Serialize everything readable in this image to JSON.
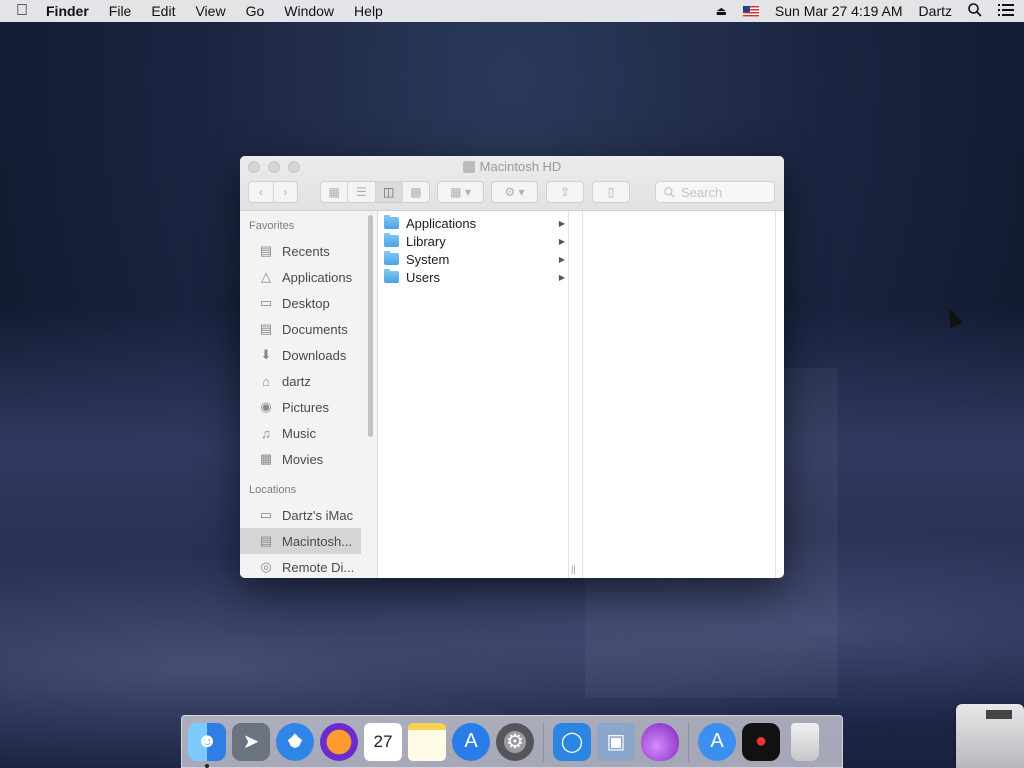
{
  "menubar": {
    "apple_icon": "apple-logo",
    "app_name": "Finder",
    "menus": [
      "File",
      "Edit",
      "View",
      "Go",
      "Window",
      "Help"
    ],
    "datetime": "Sun Mar 27  4:19 AM",
    "user": "Dartz",
    "icons": [
      "eject-icon",
      "us-flag-icon",
      "search-icon",
      "list-icon"
    ]
  },
  "window": {
    "title": "Macintosh HD",
    "search_placeholder": "Search",
    "view_modes": [
      "icon",
      "list",
      "column",
      "gallery"
    ],
    "active_view": "column"
  },
  "sidebar": {
    "favorites_heading": "Favorites",
    "favorites": [
      {
        "label": "Recents",
        "icon": "recents-icon"
      },
      {
        "label": "Applications",
        "icon": "applications-icon"
      },
      {
        "label": "Desktop",
        "icon": "desktop-icon"
      },
      {
        "label": "Documents",
        "icon": "documents-icon"
      },
      {
        "label": "Downloads",
        "icon": "downloads-icon"
      },
      {
        "label": "dartz",
        "icon": "home-icon"
      },
      {
        "label": "Pictures",
        "icon": "camera-icon"
      },
      {
        "label": "Music",
        "icon": "music-icon"
      },
      {
        "label": "Movies",
        "icon": "film-icon"
      }
    ],
    "locations_heading": "Locations",
    "locations": [
      {
        "label": "Dartz's iMac",
        "icon": "imac-icon"
      },
      {
        "label": "Macintosh...",
        "icon": "hard-drive-icon",
        "selected": true
      },
      {
        "label": "Remote Di...",
        "icon": "disc-icon"
      }
    ]
  },
  "column1": {
    "items": [
      {
        "label": "Applications",
        "icon": "folder-applications-icon"
      },
      {
        "label": "Library",
        "icon": "folder-library-icon"
      },
      {
        "label": "System",
        "icon": "folder-system-icon"
      },
      {
        "label": "Users",
        "icon": "folder-users-icon"
      }
    ]
  },
  "dock": {
    "apps": [
      {
        "name": "finder",
        "color": "#3a8ff0",
        "running": true
      },
      {
        "name": "launchpad",
        "color": "#6b7280"
      },
      {
        "name": "safari",
        "color": "#2f86e6"
      },
      {
        "name": "firefox",
        "color": "#6a2bd1"
      },
      {
        "name": "calendar",
        "color": "#ffffff",
        "text": "27"
      },
      {
        "name": "notes",
        "color": "#f7d154"
      },
      {
        "name": "app-store",
        "color": "#2a7ce8"
      },
      {
        "name": "system-preferences",
        "color": "#7d7d83"
      },
      {
        "name": "proxyman",
        "color": "#2a86e0"
      },
      {
        "name": "preview",
        "color": "#8aa6c8"
      },
      {
        "name": "potion",
        "color": "#a24bd8"
      },
      {
        "name": "app-store-downloads",
        "color": "#3a8ff0"
      },
      {
        "name": "stopwatch",
        "color": "#111111"
      },
      {
        "name": "trash",
        "color": "#d8d8dc"
      }
    ]
  }
}
